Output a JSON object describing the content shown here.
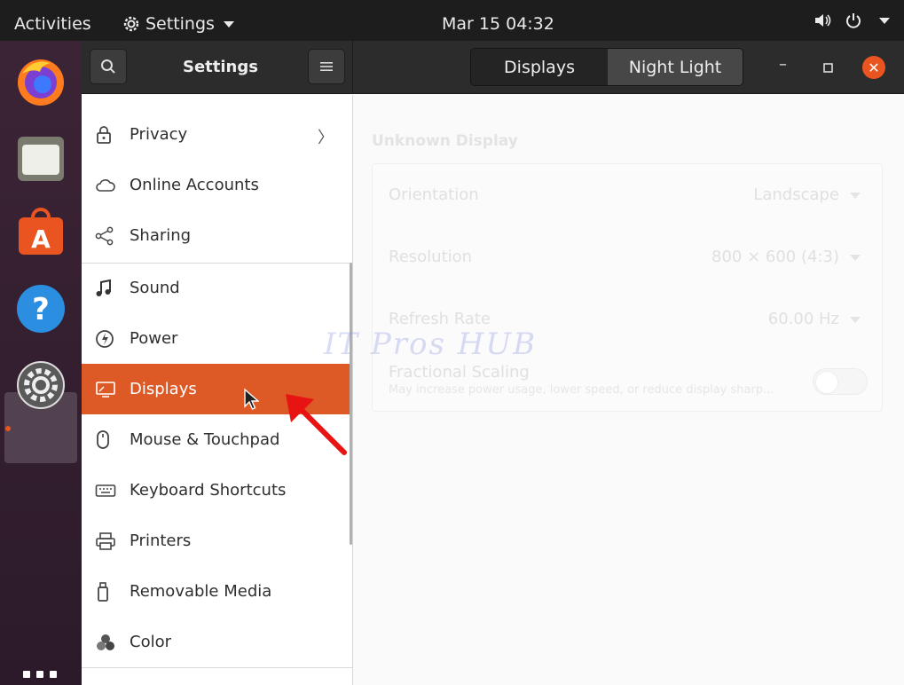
{
  "topbar": {
    "activities": "Activities",
    "app_menu": "Settings",
    "clock": "Mar 15  04:32"
  },
  "dock": {
    "items": [
      "firefox-icon",
      "files-icon",
      "software-icon",
      "help-icon",
      "settings-icon"
    ],
    "show_apps_icon": "apps-grid-icon"
  },
  "header": {
    "title": "Settings",
    "tabs": [
      "Displays",
      "Night Light"
    ],
    "active_tab": "Displays"
  },
  "sidebar": {
    "items": [
      {
        "label": "Privacy",
        "icon": "lock-icon"
      },
      {
        "label": "Online Accounts",
        "icon": "cloud-icon"
      },
      {
        "label": "Sharing",
        "icon": "share-icon"
      },
      {
        "label": "Sound",
        "icon": "music-note-icon"
      },
      {
        "label": "Power",
        "icon": "power-icon"
      },
      {
        "label": "Displays",
        "icon": "display-icon"
      },
      {
        "label": "Mouse & Touchpad",
        "icon": "mouse-icon"
      },
      {
        "label": "Keyboard Shortcuts",
        "icon": "keyboard-icon"
      },
      {
        "label": "Printers",
        "icon": "printer-icon"
      },
      {
        "label": "Removable Media",
        "icon": "usb-icon"
      },
      {
        "label": "Color",
        "icon": "color-icon"
      }
    ],
    "active": "Displays"
  },
  "display": {
    "title": "Unknown Display",
    "orientation_label": "Orientation",
    "orientation_value": "Landscape",
    "resolution_label": "Resolution",
    "resolution_value": "800 × 600 (4:3)",
    "refresh_label": "Refresh Rate",
    "refresh_value": "60.00 Hz",
    "scaling_label": "Fractional Scaling",
    "scaling_desc": "May increase power usage, lower speed, or reduce display sharp..."
  },
  "watermark": "IT Pros HUB",
  "colors": {
    "accent": "#e95420",
    "active_row": "#dd5a27",
    "topbar": "#1d1d1d",
    "header": "#2c2c2c"
  }
}
